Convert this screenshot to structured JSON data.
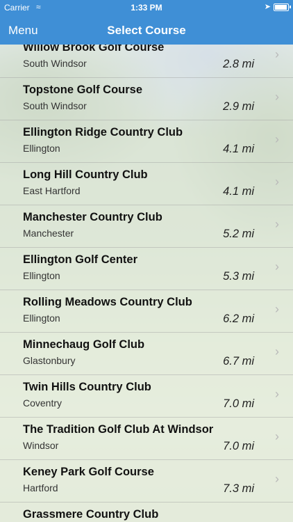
{
  "status_bar": {
    "carrier": "Carrier",
    "time": "1:33 PM"
  },
  "nav": {
    "menu_label": "Menu",
    "title": "Select Course"
  },
  "courses": [
    {
      "name": "Willow Brook Golf Course",
      "city": "South Windsor",
      "distance": "2.8 mi"
    },
    {
      "name": "Topstone Golf Course",
      "city": "South Windsor",
      "distance": "2.9 mi"
    },
    {
      "name": "Ellington Ridge Country Club",
      "city": "Ellington",
      "distance": "4.1 mi"
    },
    {
      "name": "Long Hill Country Club",
      "city": "East Hartford",
      "distance": "4.1 mi"
    },
    {
      "name": "Manchester Country Club",
      "city": "Manchester",
      "distance": "5.2 mi"
    },
    {
      "name": "Ellington Golf Center",
      "city": "Ellington",
      "distance": "5.3 mi"
    },
    {
      "name": "Rolling Meadows Country Club",
      "city": "Ellington",
      "distance": "6.2 mi"
    },
    {
      "name": "Minnechaug Golf Club",
      "city": "Glastonbury",
      "distance": "6.7 mi"
    },
    {
      "name": "Twin Hills Country Club",
      "city": "Coventry",
      "distance": "7.0 mi"
    },
    {
      "name": "The Tradition Golf Club At Windsor",
      "city": "Windsor",
      "distance": "7.0 mi"
    },
    {
      "name": "Keney Park Golf Course",
      "city": "Hartford",
      "distance": "7.3 mi"
    },
    {
      "name": "Grassmere Country Club",
      "city": "",
      "distance": ""
    }
  ]
}
